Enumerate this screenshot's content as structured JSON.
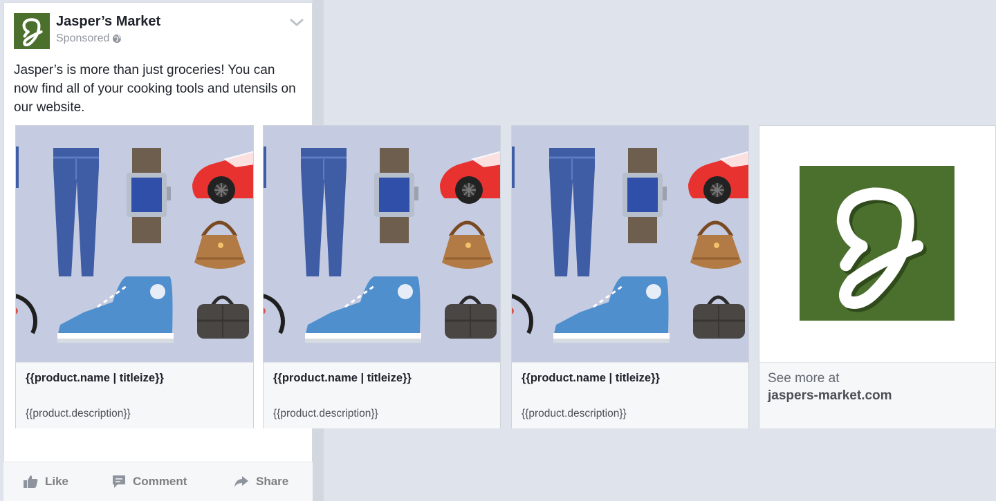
{
  "post": {
    "page_name": "Jasper’s Market",
    "sponsored_label": "Sponsored",
    "body_text": "Jasper’s is more than just groceries! You can now find all of your cooking tools and utensils on our website."
  },
  "carousel": {
    "cards": [
      {
        "title": "{{product.name | titleize}}",
        "description": "{{product.description}}"
      },
      {
        "title": "{{product.name | titleize}}",
        "description": "{{product.description}}"
      },
      {
        "title": "{{product.name | titleize}}",
        "description": "{{product.description}}"
      }
    ],
    "end_card": {
      "see_more_label": "See more at",
      "domain": "jaspers-market.com"
    }
  },
  "actions": {
    "like_label": "Like",
    "comment_label": "Comment",
    "share_label": "Share"
  },
  "colors": {
    "brand_green": "#4b6f2c",
    "card_image_bg": "#c5cbe0",
    "page_bg": "#dfe3ec"
  },
  "icons": [
    "globe-icon",
    "chevron-down-icon",
    "like-icon",
    "comment-icon",
    "share-icon"
  ]
}
